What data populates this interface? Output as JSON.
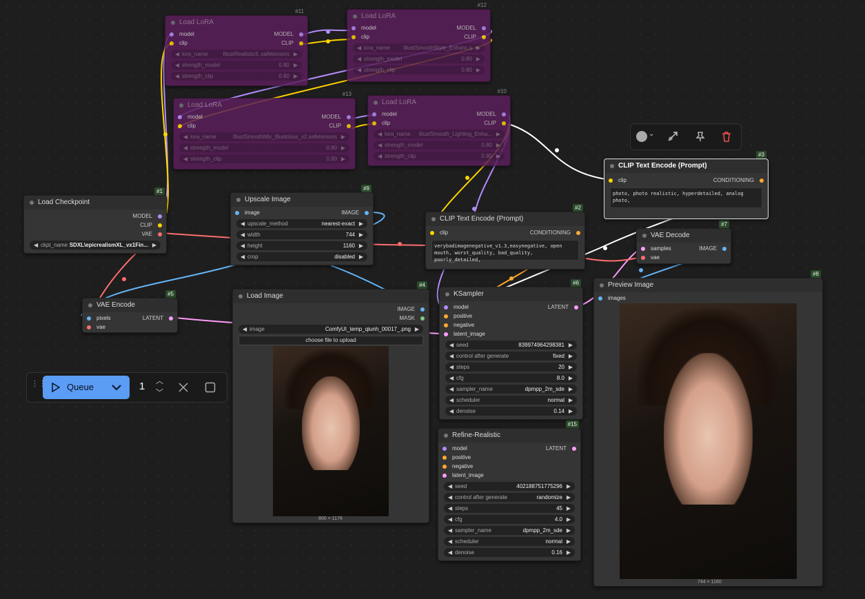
{
  "colors": {
    "model": "#b48cff",
    "clip": "#ffd500",
    "vae": "#ff6e6e",
    "image": "#64b5f6",
    "latent": "#ff9cf9",
    "conditioning": "#ffa931",
    "mask": "#81c784",
    "accent": "#5b9cf5"
  },
  "lora11": {
    "title": "Load LoRA",
    "num": "#11",
    "in_model": "model",
    "in_clip": "clip",
    "out_model": "MODEL",
    "out_clip": "CLIP",
    "lora_label": "lora_name",
    "lora_value": "IllustRealisticIl..safetensors",
    "sm_label": "strength_model",
    "sm_value": "0.80",
    "sc_label": "strength_clip",
    "sc_value": "0.80"
  },
  "lora12": {
    "title": "Load LoRA",
    "num": "#12",
    "in_model": "model",
    "in_clip": "clip",
    "out_model": "MODEL",
    "out_clip": "CLIP",
    "lora_label": "lora_name",
    "lora_value": "IllustSmoothStyle_Enhanc.s",
    "sm_label": "strength_model",
    "sm_value": "0.80",
    "sc_label": "strength_clip",
    "sc_value": "0.80"
  },
  "lora13": {
    "title": "Load LoRA",
    "num": "#13",
    "in_model": "model",
    "in_clip": "clip",
    "out_model": "MODEL",
    "out_clip": "CLIP",
    "lora_label": "lora_name",
    "lora_value": "IllustSmoothMix_Illustrious_v2.safetensors",
    "sm_label": "strength_model",
    "sm_value": "0.80",
    "sc_label": "strength_clip",
    "sc_value": "0.80"
  },
  "lora10": {
    "title": "Load LoRA",
    "num": "#10",
    "in_model": "model",
    "in_clip": "clip",
    "out_model": "MODEL",
    "out_clip": "CLIP",
    "lora_label": "lora_name",
    "lora_value": "IllustSmooth_Lighting_Enha...",
    "sm_label": "strength_model",
    "sm_value": "0.80",
    "sc_label": "strength_clip",
    "sc_value": "0.80"
  },
  "checkpoint": {
    "title": "Load Checkpoint",
    "num": "#1",
    "out_model": "MODEL",
    "out_clip": "CLIP",
    "out_vae": "VAE",
    "ckpt_label": "ckpt_name",
    "ckpt_value": "SDXL\\epicrealismXL_vx1Fin..."
  },
  "upscale": {
    "title": "Upscale Image",
    "num": "#9",
    "in_image": "image",
    "out_image": "IMAGE",
    "method_label": "upscale_method",
    "method_value": "nearest-exact",
    "width_label": "width",
    "width_value": "744",
    "height_label": "height",
    "height_value": "1160",
    "crop_label": "crop",
    "crop_value": "disabled"
  },
  "clip_neg": {
    "title": "CLIP Text Encode (Prompt)",
    "num": "#2",
    "in_clip": "clip",
    "out_cond": "CONDITIONING",
    "text": "verybadimagenegative_v1.3,easynegative, open mouth, worst_quality, bad_quality, poorly_detailed,"
  },
  "clip_pos": {
    "title": "CLIP Text Encode (Prompt)",
    "num": "#3",
    "in_clip": "clip",
    "out_cond": "CONDITIONING",
    "text": "photo, photo realistic, hyperdetailed, analog photo,"
  },
  "vae_decode": {
    "title": "VAE Decode",
    "num": "#7",
    "in_samples": "samples",
    "in_vae": "vae",
    "out_image": "IMAGE"
  },
  "vae_encode": {
    "title": "VAE Encode",
    "num": "#5",
    "in_pixels": "pixels",
    "in_vae": "vae",
    "out_latent": "LATENT"
  },
  "load_image": {
    "title": "Load Image",
    "num": "#4",
    "out_image": "IMAGE",
    "out_mask": "MASK",
    "image_label": "image",
    "image_value": "ComfyUI_temp_qiunh_00017_.png",
    "upload_label": "choose file to upload",
    "caption": "800 × 1176"
  },
  "ksampler": {
    "title": "KSampler",
    "num": "#6",
    "in_model": "model",
    "in_positive": "positive",
    "in_negative": "negative",
    "in_latent": "latent_image",
    "out_latent": "LATENT",
    "widgets": [
      {
        "label": "seed",
        "value": "839974964298381"
      },
      {
        "label": "control after generate",
        "value": "fixed"
      },
      {
        "label": "steps",
        "value": "20"
      },
      {
        "label": "cfg",
        "value": "8.0"
      },
      {
        "label": "sampler_name",
        "value": "dpmpp_2m_sde"
      },
      {
        "label": "scheduler",
        "value": "normal"
      },
      {
        "label": "denoise",
        "value": "0.14"
      }
    ]
  },
  "refine": {
    "title": "Refine-Realistic",
    "num": "#15",
    "in_model": "model",
    "in_positive": "positive",
    "in_negative": "negative",
    "in_latent": "latent_image",
    "out_latent": "LATENT",
    "widgets": [
      {
        "label": "seed",
        "value": "402188751775296"
      },
      {
        "label": "control after generate",
        "value": "randomize"
      },
      {
        "label": "steps",
        "value": "45"
      },
      {
        "label": "cfg",
        "value": "4.0"
      },
      {
        "label": "sampler_name",
        "value": "dpmpp_2m_sde"
      },
      {
        "label": "scheduler",
        "value": "normal"
      },
      {
        "label": "denoise",
        "value": "0.16"
      }
    ]
  },
  "preview": {
    "title": "Preview Image",
    "num": "#8",
    "in_images": "images",
    "caption": "744 × 1160"
  },
  "queue": {
    "label": "Queue",
    "count": "1"
  },
  "icons": {
    "play": "play-icon",
    "chevron": "chevron-down-icon",
    "close": "close-icon",
    "stop": "square-icon",
    "color": "color-circle-icon",
    "bypass": "bypass-icon",
    "pin": "pin-icon",
    "delete": "trash-icon"
  }
}
